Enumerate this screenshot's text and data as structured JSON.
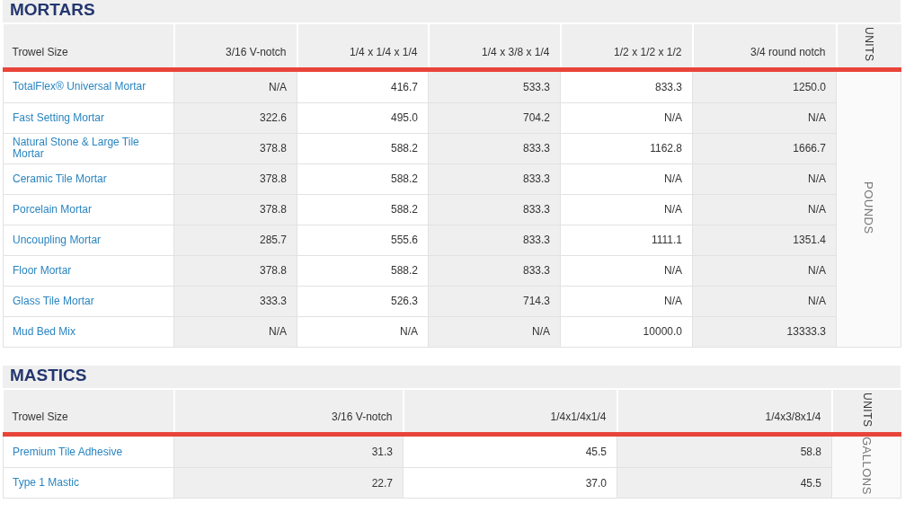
{
  "sections": [
    {
      "title": "MORTARS",
      "columns": [
        "Trowel Size",
        "3/16 V-notch",
        "1/4 x 1/4 x 1/4",
        "1/4 x 3/8 x 1/4",
        "1/2 x 1/2 x 1/2",
        "3/4 round notch"
      ],
      "units_heading": "UNITS",
      "units": "POUNDS",
      "rows": [
        {
          "name": "TotalFlex® Universal Mortar",
          "values": [
            "N/A",
            "416.7",
            "533.3",
            "833.3",
            "1250.0"
          ]
        },
        {
          "name": "Fast Setting Mortar",
          "values": [
            "322.6",
            "495.0",
            "704.2",
            "N/A",
            "N/A"
          ]
        },
        {
          "name": "Natural Stone & Large Tile Mortar",
          "values": [
            "378.8",
            "588.2",
            "833.3",
            "1162.8",
            "1666.7"
          ]
        },
        {
          "name": "Ceramic Tile Mortar",
          "values": [
            "378.8",
            "588.2",
            "833.3",
            "N/A",
            "N/A"
          ]
        },
        {
          "name": "Porcelain Mortar",
          "values": [
            "378.8",
            "588.2",
            "833.3",
            "N/A",
            "N/A"
          ]
        },
        {
          "name": "Uncoupling Mortar",
          "values": [
            "285.7",
            "555.6",
            "833.3",
            "1111.1",
            "1351.4"
          ]
        },
        {
          "name": "Floor Mortar",
          "values": [
            "378.8",
            "588.2",
            "833.3",
            "N/A",
            "N/A"
          ]
        },
        {
          "name": "Glass Tile Mortar",
          "values": [
            "333.3",
            "526.3",
            "714.3",
            "N/A",
            "N/A"
          ]
        },
        {
          "name": "Mud Bed Mix",
          "values": [
            "N/A",
            "N/A",
            "N/A",
            "10000.0",
            "13333.3"
          ]
        }
      ]
    },
    {
      "title": "MASTICS",
      "columns": [
        "Trowel Size",
        "3/16 V-notch",
        "1/4x1/4x1/4",
        "1/4x3/8x1/4"
      ],
      "units_heading": "UNITS",
      "units": "GALLONS",
      "rows": [
        {
          "name": "Premium Tile Adhesive",
          "values": [
            "31.3",
            "45.5",
            "58.8"
          ]
        },
        {
          "name": "Type 1 Mastic",
          "values": [
            "22.7",
            "37.0",
            "45.5"
          ]
        }
      ]
    }
  ]
}
